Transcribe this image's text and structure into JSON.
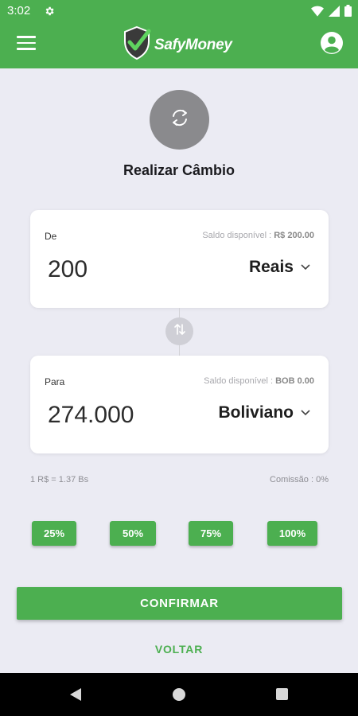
{
  "status_bar": {
    "time": "3:02"
  },
  "app_bar": {
    "brand": "SafyMoney"
  },
  "page": {
    "title": "Realizar Câmbio"
  },
  "from_card": {
    "label": "De",
    "saldo_label": "Saldo disponível :",
    "saldo_value": "R$ 200.00",
    "amount": "200",
    "currency": "Reais"
  },
  "to_card": {
    "label": "Para",
    "saldo_label": "Saldo disponível :",
    "saldo_value": "BOB 0.00",
    "amount": "274.000",
    "currency": "Boliviano"
  },
  "rate": {
    "text": "1 R$ = 1.37 Bs",
    "commission": "Comissão : 0%"
  },
  "percent_buttons": [
    "25%",
    "50%",
    "75%",
    "100%"
  ],
  "actions": {
    "confirm": "CONFIRMAR",
    "back": "VOLTAR"
  },
  "colors": {
    "primary": "#4caf50",
    "background": "#ebebf3",
    "circle": "#8a8a8d"
  }
}
